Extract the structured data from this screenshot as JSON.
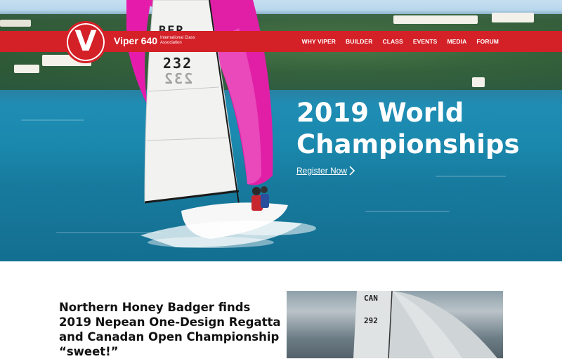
{
  "header": {
    "logo_letter": "V",
    "brand_name": "Viper 640",
    "brand_subtitle": "International Class Association",
    "brand_color": "#d42027"
  },
  "nav": {
    "items": [
      "WHY VIPER",
      "BUILDER",
      "CLASS",
      "EVENTS",
      "MEDIA",
      "FORUM"
    ]
  },
  "hero": {
    "title_line1": "2019 World",
    "title_line2": "Championships",
    "cta_label": "Register Now",
    "cta_icon": "chevron-right-icon",
    "sail_number_top": "232",
    "sail_number_mirror": "232",
    "sail_prefix": "BER"
  },
  "news": {
    "headline": "Northern Honey Badger finds 2019 Nepean One-Design Regatta and Canadan Open Championship “sweet!”",
    "photo_sail_prefix": "CAN",
    "photo_sail_number": "292"
  }
}
